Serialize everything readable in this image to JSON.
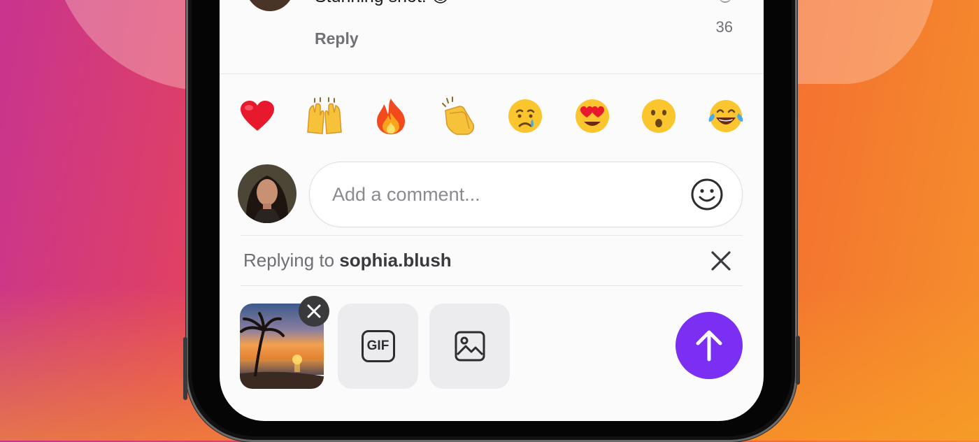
{
  "comment": {
    "text": "Stunning shot! 😍",
    "reply_label": "Reply",
    "like_count": "36"
  },
  "reactions": [
    {
      "emoji": "❤️",
      "name": "heart"
    },
    {
      "emoji": "🙌",
      "name": "raised-hands"
    },
    {
      "emoji": "🔥",
      "name": "fire"
    },
    {
      "emoji": "👏",
      "name": "clapping-hands"
    },
    {
      "emoji": "😢",
      "name": "crying-face"
    },
    {
      "emoji": "😍",
      "name": "heart-eyes"
    },
    {
      "emoji": "😮",
      "name": "surprised-face"
    },
    {
      "emoji": "😂",
      "name": "tears-of-joy"
    }
  ],
  "composer": {
    "placeholder": "Add a comment...",
    "replying_prefix": "Replying to",
    "replying_user": "sophia.blush",
    "gif_label": "GIF"
  },
  "colors": {
    "send_button": "#7a2ff2",
    "accent_background_start": "#c8348f",
    "accent_background_end": "#f58f2c"
  }
}
